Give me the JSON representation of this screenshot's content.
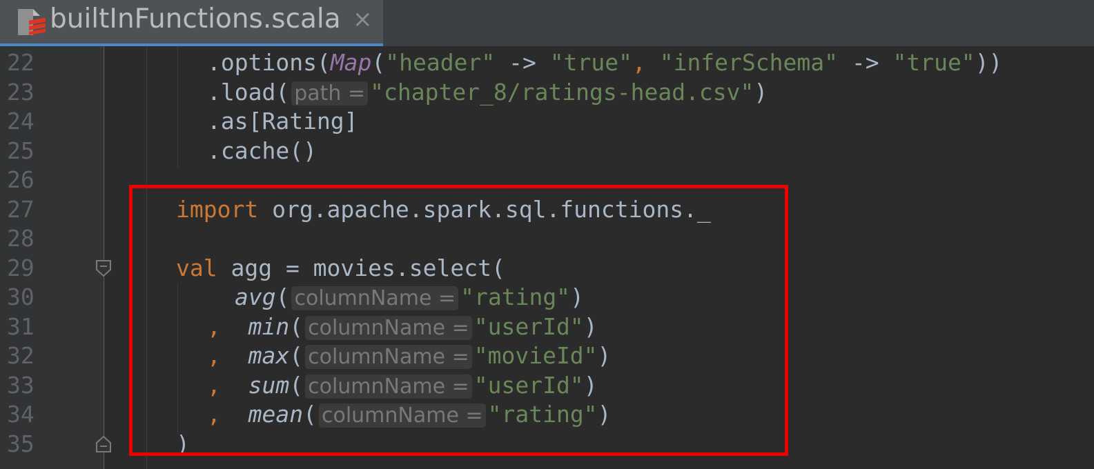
{
  "tab": {
    "title": "builtInFunctions.scala",
    "close": "×",
    "icon": "scala-file-icon"
  },
  "lines": [
    {
      "n": "22"
    },
    {
      "n": "23"
    },
    {
      "n": "24"
    },
    {
      "n": "25"
    },
    {
      "n": "26"
    },
    {
      "n": "27"
    },
    {
      "n": "28"
    },
    {
      "n": "29"
    },
    {
      "n": "30"
    },
    {
      "n": "31"
    },
    {
      "n": "32"
    },
    {
      "n": "33"
    },
    {
      "n": "34"
    },
    {
      "n": "35"
    }
  ],
  "code": {
    "l22": {
      "a": ".options(",
      "map": "Map",
      "b": "(",
      "s1": "\"header\"",
      "c": " -> ",
      "s2": "\"true\"",
      "comma": ", ",
      "s3": "\"inferSchema\"",
      "d": " -> ",
      "s4": "\"true\"",
      "e": "))"
    },
    "l23": {
      "a": ".load(",
      "hint": "path =",
      "s": "\"chapter_8/ratings-head.csv\"",
      "b": ")"
    },
    "l24": {
      "a": ".as[Rating]"
    },
    "l25": {
      "a": ".cache()"
    },
    "l27": {
      "kw": "import",
      "a": " org.apache.spark.sql.functions._"
    },
    "l29": {
      "kw": "val",
      "a": " agg = movies.select("
    },
    "l30": {
      "fn": "avg",
      "p": "(",
      "hint": "columnName =",
      "s": "\"rating\"",
      "b": ")"
    },
    "l31": {
      "comma": ",",
      "fn": "min",
      "p": "(",
      "hint": "columnName =",
      "s": "\"userId\"",
      "b": ")"
    },
    "l32": {
      "comma": ",",
      "fn": "max",
      "p": "(",
      "hint": "columnName =",
      "s": "\"movieId\"",
      "b": ")"
    },
    "l33": {
      "comma": ",",
      "fn": "sum",
      "p": "(",
      "hint": "columnName =",
      "s": "\"userId\"",
      "b": ")"
    },
    "l34": {
      "comma": ",",
      "fn": "mean",
      "p": "(",
      "hint": "columnName =",
      "s": "\"rating\"",
      "b": ")"
    },
    "l35": {
      "a": ")"
    }
  },
  "colors": {
    "string": "#6a8759",
    "keyword": "#cc7832",
    "highlight_box": "#ee0000",
    "tab_underline": "#4a88c7"
  }
}
